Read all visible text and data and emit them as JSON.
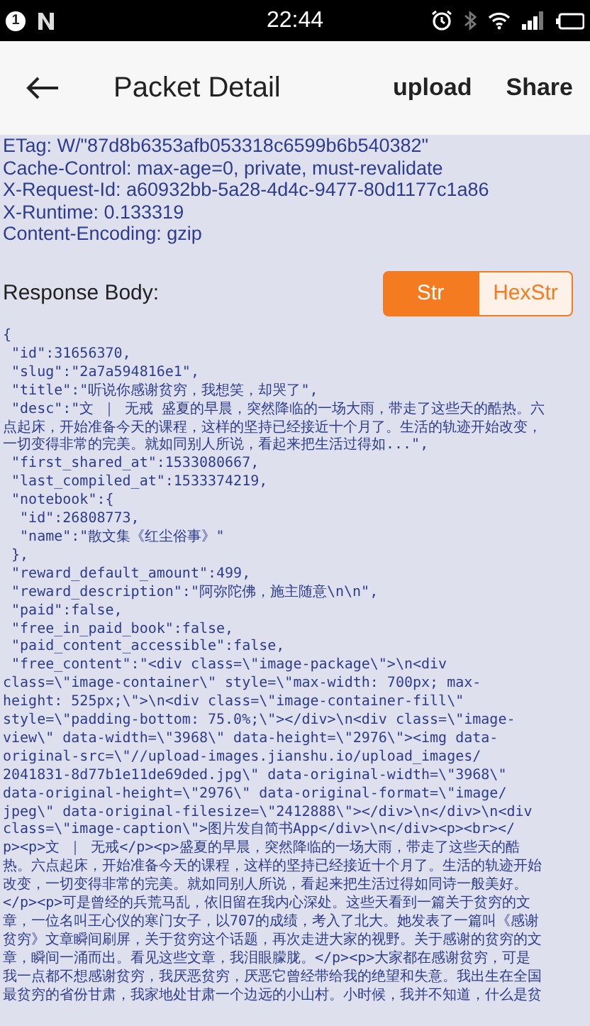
{
  "status_bar": {
    "notification_count": "1",
    "time": "22:44"
  },
  "header": {
    "title": "Packet Detail",
    "actions": [
      "upload",
      "Share"
    ]
  },
  "headers": [
    "ETag: W/\"87d8b6353afb053318c6599b6b540382\"",
    "Cache-Control: max-age=0, private, must-revalidate",
    "X-Request-Id: a60932bb-5a28-4d4c-9477-80d1177c1a86",
    "X-Runtime: 0.133319",
    "Content-Encoding: gzip"
  ],
  "response_body": {
    "label": "Response Body:",
    "formats": [
      {
        "label": "Str",
        "selected": true
      },
      {
        "label": "HexStr",
        "selected": false
      }
    ],
    "lines": [
      "{",
      " \"id\":31656370,",
      " \"slug\":\"2a7a594816e1\",",
      " \"title\":\"听说你感谢贫穷，我想笑，却哭了\",",
      " \"desc\":\"文 ｜ 无戒 盛夏的早晨，突然降临的一场大雨，带走了这些天的酷热。六",
      "点起床，开始准备今天的课程，这样的坚持已经接近十个月了。生活的轨迹开始改变，",
      "一切变得非常的完美。就如同别人所说，看起来把生活过得如...\",",
      " \"first_shared_at\":1533080667,",
      " \"last_compiled_at\":1533374219,",
      " \"notebook\":{",
      "  \"id\":26808773,",
      "  \"name\":\"散文集《红尘俗事》\"",
      " },",
      " \"reward_default_amount\":499,",
      " \"reward_description\":\"阿弥陀佛，施主随意\\n\\n\",",
      " \"paid\":false,",
      " \"free_in_paid_book\":false,",
      " \"paid_content_accessible\":false,",
      " \"free_content\":\"<div class=\\\"image-package\\\">\\n<div",
      "class=\\\"image-container\\\" style=\\\"max-width: 700px; max-",
      "height: 525px;\\\">\\n<div class=\\\"image-container-fill\\\"",
      "style=\\\"padding-bottom: 75.0%;\\\"></div>\\n<div class=\\\"image-",
      "view\\\" data-width=\\\"3968\\\" data-height=\\\"2976\\\"><img data-",
      "original-src=\\\"//upload-images.jianshu.io/upload_images/",
      "2041831-8d77b1e11de69ded.jpg\\\" data-original-width=\\\"3968\\\"",
      "data-original-height=\\\"2976\\\" data-original-format=\\\"image/",
      "jpeg\\\" data-original-filesize=\\\"2412888\\\"></div>\\n</div>\\n<div",
      "class=\\\"image-caption\\\">图片发自简书App</div>\\n</div><p><br></",
      "p><p>文 ｜ 无戒</p><p>盛夏的早晨，突然降临的一场大雨，带走了这些天的酷",
      "热。六点起床，开始准备今天的课程，这样的坚持已经接近十个月了。生活的轨迹开始",
      "改变，一切变得非常的完美。就如同别人所说，看起来把生活过得如同诗一般美好。",
      "</p><p>可是曾经的兵荒马乱，依旧留在我内心深处。这些天看到一篇关于贫穷的文",
      "章，一位名叫王心仪的寒门女子，以707的成绩，考入了北大。她发表了一篇叫《感谢",
      "贫穷》文章瞬间刷屏，关于贫穷这个话题，再次走进大家的视野。关于感谢的贫穷的文",
      "章，瞬间一涌而出。看见这些文章，我泪眼朦胧。</p><p>大家都在感谢贫穷，可是",
      "我一点都不想感谢贫穷，我厌恶贫穷，厌恶它曾经带给我的绝望和失意。我出生在全国",
      "最贫穷的省份甘肃，我家地处甘肃一个边远的小山村。小时候，我并不知道，什么是贫"
    ]
  }
}
